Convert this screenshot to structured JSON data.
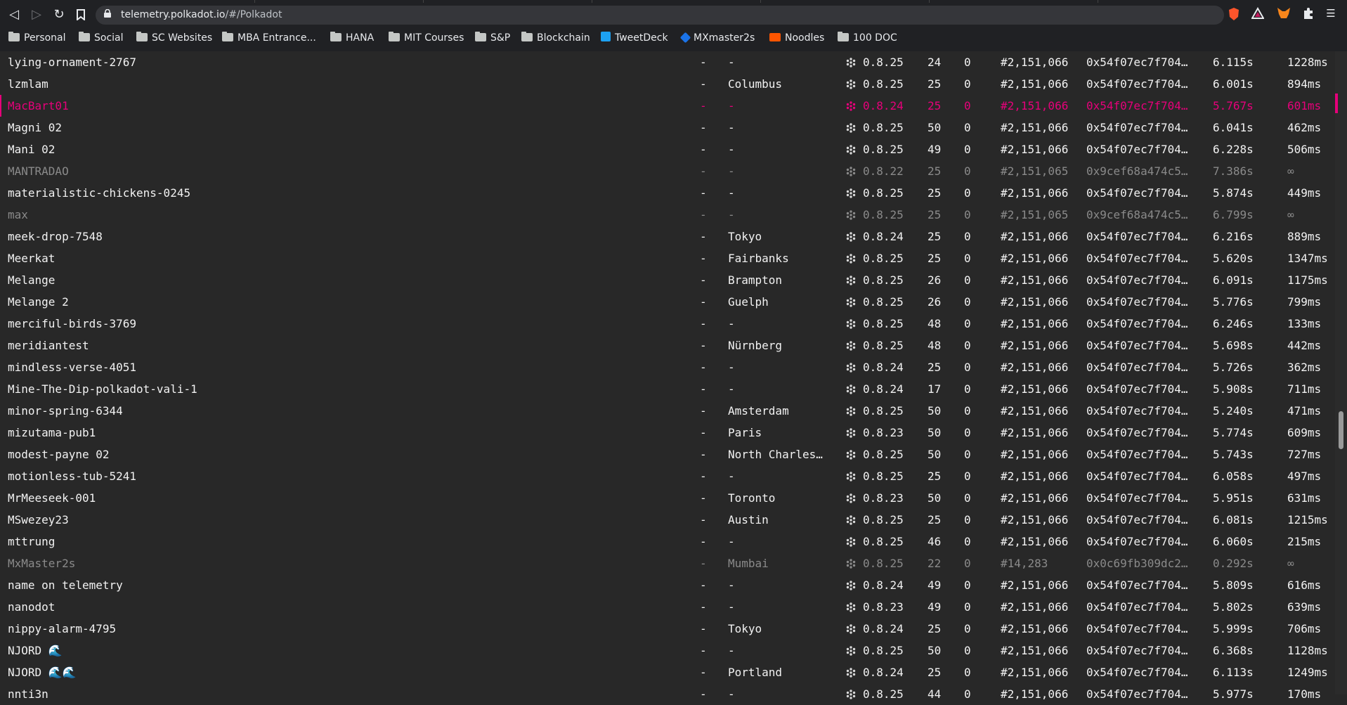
{
  "browser": {
    "url_domain": "telemetry.polkadot.io",
    "url_path": "/#/Polkadot",
    "bookmarks": [
      {
        "label": "Personal",
        "icon": "folder-icon"
      },
      {
        "label": "Social",
        "icon": "folder-icon"
      },
      {
        "label": "SC Websites",
        "icon": "folder-icon"
      },
      {
        "label": "MBA Entrance...",
        "icon": "folder-icon"
      },
      {
        "label": "HANA",
        "icon": "folder-icon"
      },
      {
        "label": "MIT Courses",
        "icon": "folder-icon"
      },
      {
        "label": "S&P",
        "icon": "folder-icon"
      },
      {
        "label": "Blockchain",
        "icon": "folder-icon"
      },
      {
        "label": "TweetDeck",
        "icon": "twitter-icon"
      },
      {
        "label": "MXmaster2s",
        "icon": "diamond-icon"
      },
      {
        "label": "Noodles",
        "icon": "soundcloud-icon"
      },
      {
        "label": "100 DOC",
        "icon": "folder-icon"
      }
    ]
  },
  "colors": {
    "accent": "#e6007a",
    "text": "#f2f2f2",
    "stale": "#8a8a8a",
    "background": "#282828"
  },
  "nodes": [
    {
      "name": "lying-ornament-2767",
      "impl": "-",
      "location": "-",
      "version": "0.8.25",
      "peers": "24",
      "txs": "0",
      "block": "#2,151,066",
      "hash": "0x54f07ec7f704…",
      "time": "6.115s",
      "latency": "1228ms",
      "state": "normal"
    },
    {
      "name": "lzmlam",
      "impl": "-",
      "location": "Columbus",
      "version": "0.8.25",
      "peers": "25",
      "txs": "0",
      "block": "#2,151,066",
      "hash": "0x54f07ec7f704…",
      "time": "6.001s",
      "latency": "894ms",
      "state": "normal"
    },
    {
      "name": "MacBart01",
      "impl": "-",
      "location": "-",
      "version": "0.8.24",
      "peers": "25",
      "txs": "0",
      "block": "#2,151,066",
      "hash": "0x54f07ec7f704…",
      "time": "5.767s",
      "latency": "601ms",
      "state": "selected"
    },
    {
      "name": "Magni 02",
      "impl": "-",
      "location": "-",
      "version": "0.8.25",
      "peers": "50",
      "txs": "0",
      "block": "#2,151,066",
      "hash": "0x54f07ec7f704…",
      "time": "6.041s",
      "latency": "462ms",
      "state": "normal"
    },
    {
      "name": "Mani 02",
      "impl": "-",
      "location": "-",
      "version": "0.8.25",
      "peers": "49",
      "txs": "0",
      "block": "#2,151,066",
      "hash": "0x54f07ec7f704…",
      "time": "6.228s",
      "latency": "506ms",
      "state": "normal"
    },
    {
      "name": "MANTRADAO",
      "impl": "-",
      "location": "-",
      "version": "0.8.22",
      "peers": "25",
      "txs": "0",
      "block": "#2,151,065",
      "hash": "0x9cef68a474c5…",
      "time": "7.386s",
      "latency": "∞",
      "state": "stale"
    },
    {
      "name": "materialistic-chickens-0245",
      "impl": "-",
      "location": "-",
      "version": "0.8.25",
      "peers": "25",
      "txs": "0",
      "block": "#2,151,066",
      "hash": "0x54f07ec7f704…",
      "time": "5.874s",
      "latency": "449ms",
      "state": "normal"
    },
    {
      "name": "max",
      "impl": "-",
      "location": "-",
      "version": "0.8.25",
      "peers": "25",
      "txs": "0",
      "block": "#2,151,065",
      "hash": "0x9cef68a474c5…",
      "time": "6.799s",
      "latency": "∞",
      "state": "stale"
    },
    {
      "name": "meek-drop-7548",
      "impl": "-",
      "location": "Tokyo",
      "version": "0.8.24",
      "peers": "25",
      "txs": "0",
      "block": "#2,151,066",
      "hash": "0x54f07ec7f704…",
      "time": "6.216s",
      "latency": "889ms",
      "state": "normal"
    },
    {
      "name": "Meerkat",
      "impl": "-",
      "location": "Fairbanks",
      "version": "0.8.25",
      "peers": "25",
      "txs": "0",
      "block": "#2,151,066",
      "hash": "0x54f07ec7f704…",
      "time": "5.620s",
      "latency": "1347ms",
      "state": "normal"
    },
    {
      "name": "Melange",
      "impl": "-",
      "location": "Brampton",
      "version": "0.8.25",
      "peers": "26",
      "txs": "0",
      "block": "#2,151,066",
      "hash": "0x54f07ec7f704…",
      "time": "6.091s",
      "latency": "1175ms",
      "state": "normal"
    },
    {
      "name": "Melange 2",
      "impl": "-",
      "location": "Guelph",
      "version": "0.8.25",
      "peers": "26",
      "txs": "0",
      "block": "#2,151,066",
      "hash": "0x54f07ec7f704…",
      "time": "5.776s",
      "latency": "799ms",
      "state": "normal"
    },
    {
      "name": "merciful-birds-3769",
      "impl": "-",
      "location": "-",
      "version": "0.8.25",
      "peers": "48",
      "txs": "0",
      "block": "#2,151,066",
      "hash": "0x54f07ec7f704…",
      "time": "6.246s",
      "latency": "133ms",
      "state": "normal"
    },
    {
      "name": "meridiantest",
      "impl": "-",
      "location": "Nürnberg",
      "version": "0.8.25",
      "peers": "48",
      "txs": "0",
      "block": "#2,151,066",
      "hash": "0x54f07ec7f704…",
      "time": "5.698s",
      "latency": "442ms",
      "state": "normal"
    },
    {
      "name": "mindless-verse-4051",
      "impl": "-",
      "location": "-",
      "version": "0.8.24",
      "peers": "25",
      "txs": "0",
      "block": "#2,151,066",
      "hash": "0x54f07ec7f704…",
      "time": "5.726s",
      "latency": "362ms",
      "state": "normal"
    },
    {
      "name": "Mine-The-Dip-polkadot-vali-1",
      "impl": "-",
      "location": "-",
      "version": "0.8.24",
      "peers": "17",
      "txs": "0",
      "block": "#2,151,066",
      "hash": "0x54f07ec7f704…",
      "time": "5.908s",
      "latency": "711ms",
      "state": "normal"
    },
    {
      "name": "minor-spring-6344",
      "impl": "-",
      "location": "Amsterdam",
      "version": "0.8.25",
      "peers": "50",
      "txs": "0",
      "block": "#2,151,066",
      "hash": "0x54f07ec7f704…",
      "time": "5.240s",
      "latency": "471ms",
      "state": "normal"
    },
    {
      "name": "mizutama-pub1",
      "impl": "-",
      "location": "Paris",
      "version": "0.8.23",
      "peers": "50",
      "txs": "0",
      "block": "#2,151,066",
      "hash": "0x54f07ec7f704…",
      "time": "5.774s",
      "latency": "609ms",
      "state": "normal"
    },
    {
      "name": "modest-payne 02",
      "impl": "-",
      "location": "North Charles…",
      "version": "0.8.25",
      "peers": "50",
      "txs": "0",
      "block": "#2,151,066",
      "hash": "0x54f07ec7f704…",
      "time": "5.743s",
      "latency": "727ms",
      "state": "normal"
    },
    {
      "name": "motionless-tub-5241",
      "impl": "-",
      "location": "-",
      "version": "0.8.25",
      "peers": "25",
      "txs": "0",
      "block": "#2,151,066",
      "hash": "0x54f07ec7f704…",
      "time": "6.058s",
      "latency": "497ms",
      "state": "normal"
    },
    {
      "name": "MrMeeseek-001",
      "impl": "-",
      "location": "Toronto",
      "version": "0.8.23",
      "peers": "50",
      "txs": "0",
      "block": "#2,151,066",
      "hash": "0x54f07ec7f704…",
      "time": "5.951s",
      "latency": "631ms",
      "state": "normal"
    },
    {
      "name": "MSwezey23",
      "impl": "-",
      "location": "Austin",
      "version": "0.8.25",
      "peers": "25",
      "txs": "0",
      "block": "#2,151,066",
      "hash": "0x54f07ec7f704…",
      "time": "6.081s",
      "latency": "1215ms",
      "state": "normal"
    },
    {
      "name": "mttrung",
      "impl": "-",
      "location": "-",
      "version": "0.8.25",
      "peers": "46",
      "txs": "0",
      "block": "#2,151,066",
      "hash": "0x54f07ec7f704…",
      "time": "6.060s",
      "latency": "215ms",
      "state": "normal"
    },
    {
      "name": "MxMaster2s",
      "impl": "-",
      "location": "Mumbai",
      "version": "0.8.25",
      "peers": "22",
      "txs": "0",
      "block": "#14,283",
      "hash": "0x0c69fb309dc2…",
      "time": "0.292s",
      "latency": "∞",
      "state": "stale"
    },
    {
      "name": "name on telemetry",
      "impl": "-",
      "location": "-",
      "version": "0.8.24",
      "peers": "49",
      "txs": "0",
      "block": "#2,151,066",
      "hash": "0x54f07ec7f704…",
      "time": "5.809s",
      "latency": "616ms",
      "state": "normal"
    },
    {
      "name": "nanodot",
      "impl": "-",
      "location": "-",
      "version": "0.8.23",
      "peers": "49",
      "txs": "0",
      "block": "#2,151,066",
      "hash": "0x54f07ec7f704…",
      "time": "5.802s",
      "latency": "639ms",
      "state": "normal"
    },
    {
      "name": "nippy-alarm-4795",
      "impl": "-",
      "location": "Tokyo",
      "version": "0.8.24",
      "peers": "25",
      "txs": "0",
      "block": "#2,151,066",
      "hash": "0x54f07ec7f704…",
      "time": "5.999s",
      "latency": "706ms",
      "state": "normal"
    },
    {
      "name": "NJORD 🌊",
      "impl": "-",
      "location": "-",
      "version": "0.8.25",
      "peers": "50",
      "txs": "0",
      "block": "#2,151,066",
      "hash": "0x54f07ec7f704…",
      "time": "6.368s",
      "latency": "1128ms",
      "state": "normal"
    },
    {
      "name": "NJORD 🌊🌊",
      "impl": "-",
      "location": "Portland",
      "version": "0.8.24",
      "peers": "25",
      "txs": "0",
      "block": "#2,151,066",
      "hash": "0x54f07ec7f704…",
      "time": "6.113s",
      "latency": "1249ms",
      "state": "normal"
    },
    {
      "name": "nnti3n",
      "impl": "-",
      "location": "-",
      "version": "0.8.25",
      "peers": "44",
      "txs": "0",
      "block": "#2,151,066",
      "hash": "0x54f07ec7f704…",
      "time": "5.977s",
      "latency": "170ms",
      "state": "normal"
    }
  ]
}
